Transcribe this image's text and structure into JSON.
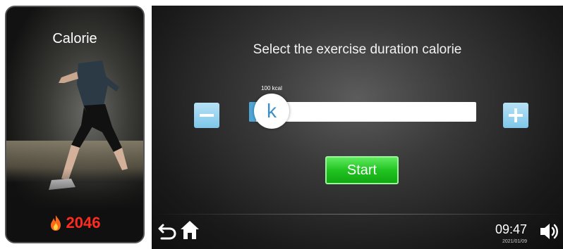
{
  "left_card": {
    "title": "Calorie",
    "calorie_value": "2046",
    "flame_icon": "flame-icon",
    "value_color": "#ff2b1e"
  },
  "main": {
    "title": "Select the exercise duration calorie",
    "slider": {
      "label": "100 kcal",
      "knob_text": "k",
      "fill_fraction": 0.03
    },
    "minus_icon": "minus-icon",
    "plus_icon": "plus-icon",
    "start_label": "Start",
    "start_color": "#21c421",
    "accent_color": "#7ec6ea"
  },
  "footer": {
    "back_icon": "back-icon",
    "home_icon": "home-icon",
    "time": "09:47",
    "date": "2021/01/09",
    "speaker_icon": "speaker-icon"
  }
}
